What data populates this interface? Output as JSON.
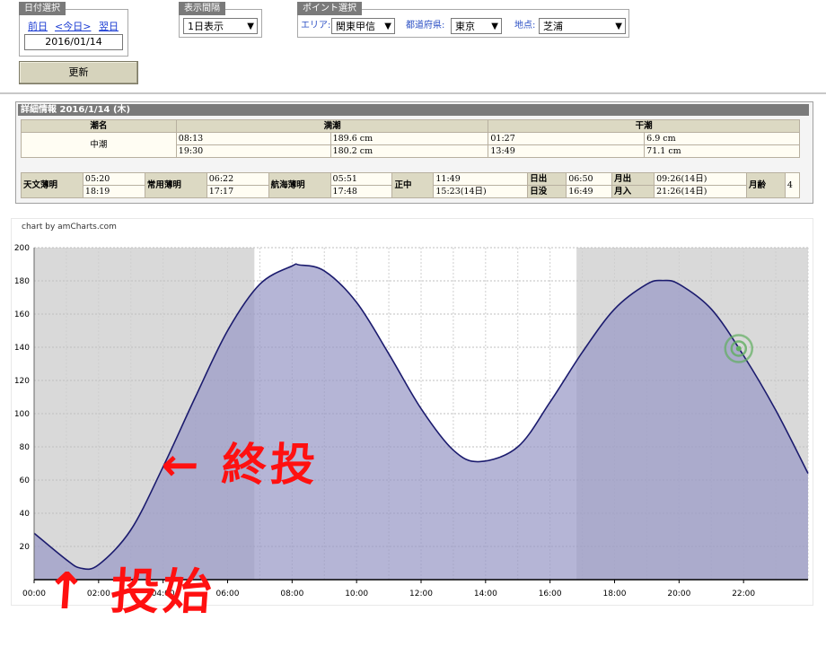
{
  "date_select": {
    "legend": "日付選択",
    "prev": "前日",
    "today": "<今日>",
    "next": "翌日",
    "date_value": "2016/01/14",
    "update_label": "更新"
  },
  "display": {
    "legend": "表示間隔",
    "value": "1日表示"
  },
  "point": {
    "legend": "ポイント選択",
    "area_label": "エリア:",
    "area_value": "関東甲信",
    "pref_label": "都道府県:",
    "pref_value": "東京",
    "spot_label": "地点:",
    "spot_value": "芝浦"
  },
  "detail": {
    "title": "詳細情報  2016/1/14 (木)",
    "tide_header": {
      "name": "潮名",
      "high": "満潮",
      "low": "干潮"
    },
    "tide_name": "中潮",
    "high": [
      {
        "time": "08:13",
        "height": "189.6 cm"
      },
      {
        "time": "19:30",
        "height": "180.2 cm"
      }
    ],
    "low": [
      {
        "time": "01:27",
        "height": "6.9 cm"
      },
      {
        "time": "13:49",
        "height": "71.1 cm"
      }
    ],
    "astro": {
      "tenmon_label": "天文薄明",
      "tenmon": [
        "05:20",
        "18:19"
      ],
      "joyo_label": "常用薄明",
      "joyo": [
        "06:22",
        "17:17"
      ],
      "kokai_label": "航海薄明",
      "kokai": [
        "05:51",
        "17:48"
      ],
      "shochu_label": "正中",
      "shochu": [
        "11:49",
        "15:23(14日)"
      ],
      "sun_rise_label": "日出",
      "sun_rise": "06:50",
      "sun_set_label": "日没",
      "sun_set": "16:49",
      "moon_rise_label": "月出",
      "moon_rise": "09:26(14日)",
      "moon_set_label": "月入",
      "moon_set": "21:26(14日)",
      "moon_age_label": "月齢",
      "moon_age": "4"
    }
  },
  "chart_credit": "chart by amCharts.com",
  "chart_data": {
    "type": "area",
    "x_unit": "hour",
    "x": [
      0,
      1,
      1.45,
      2,
      3,
      4,
      5,
      6,
      7,
      8,
      8.22,
      9,
      10,
      11,
      12,
      13,
      13.82,
      15,
      16,
      17,
      18,
      19,
      19.5,
      20,
      21,
      22,
      23,
      24
    ],
    "y": [
      28,
      12,
      6.9,
      9,
      30,
      68,
      110,
      150,
      178,
      189,
      189.6,
      186,
      167,
      136,
      103,
      78,
      71.1,
      80,
      107,
      137,
      163,
      178,
      180.2,
      178,
      163,
      135,
      102,
      64
    ],
    "ylim": [
      0,
      200
    ],
    "yticks": [
      20,
      40,
      60,
      80,
      100,
      120,
      140,
      160,
      180,
      200
    ],
    "xlim": [
      0,
      24
    ],
    "xticks": [
      "00:00",
      "02:00",
      "04:00",
      "06:00",
      "08:00",
      "10:00",
      "12:00",
      "14:00",
      "16:00",
      "18:00",
      "20:00",
      "22:00"
    ],
    "night_bands": [
      [
        0,
        6.83
      ],
      [
        16.82,
        24
      ]
    ],
    "series_color": "#1b1b6e",
    "fill_color": "#9898c6",
    "marker_hour": 21.85,
    "marker_color": "#5fae5f",
    "grid": true
  },
  "annotations": {
    "end_label": "← 終投",
    "start_label": "投始"
  }
}
